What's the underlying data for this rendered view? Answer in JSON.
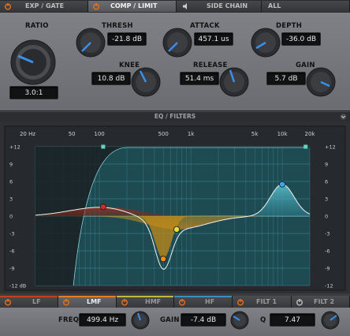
{
  "tabs": [
    {
      "label": "EXP / GATE",
      "active": false
    },
    {
      "label": "COMP / LIMIT",
      "active": true
    },
    {
      "label": "SIDE CHAIN",
      "active": false
    },
    {
      "label": "ALL",
      "active": false
    }
  ],
  "dynamics": {
    "ratio": {
      "label": "RATIO",
      "value": "3.0:1"
    },
    "thresh": {
      "label": "THRESH",
      "value": "-21.8 dB"
    },
    "knee": {
      "label": "KNEE",
      "value": "10.8 dB"
    },
    "attack": {
      "label": "ATTACK",
      "value": "457.1 us"
    },
    "release": {
      "label": "RELEASE",
      "value": "51.4 ms"
    },
    "depth": {
      "label": "DEPTH",
      "value": "-36.0 dB"
    },
    "gain": {
      "label": "GAIN",
      "value": "5.7 dB"
    }
  },
  "eq": {
    "title": "EQ / FILTERS",
    "freq_labels": [
      "20 Hz",
      "50",
      "100",
      "500",
      "1k",
      "5k",
      "10k",
      "20k"
    ],
    "db_labels": [
      "+12",
      "9",
      "6",
      "3",
      "0",
      "-3",
      "-6",
      "-9",
      "-12 dB"
    ],
    "db_labels_right": [
      "+12",
      "9",
      "6",
      "3",
      "0",
      "-3",
      "-6",
      "-9",
      "-12"
    ],
    "nodes": [
      {
        "band": "LMF",
        "freq_hz": 499.4,
        "gain_db": -7.4,
        "color": "#f08a1a"
      },
      {
        "band": "LF",
        "freq_hz": 110,
        "gain_db": 1.6,
        "color": "#d42a2a"
      },
      {
        "band": "HMF",
        "freq_hz": 700,
        "gain_db": -2.3,
        "color": "#e6e23a"
      },
      {
        "band": "HF",
        "freq_hz": 10000,
        "gain_db": 5.5,
        "color": "#3aa6e8"
      }
    ]
  },
  "bands": [
    {
      "label": "LF",
      "color": "#c04020",
      "active": false
    },
    {
      "label": "LMF",
      "color": "#e08020",
      "active": true
    },
    {
      "label": "HMF",
      "color": "#c0b840",
      "active": false
    },
    {
      "label": "HF",
      "color": "#3a90b8",
      "active": false
    },
    {
      "label": "FILT 1",
      "color": "#5a5c60",
      "active": false
    },
    {
      "label": "FILT 2",
      "color": "#5a5c60",
      "active": false
    }
  ],
  "band_controls": {
    "freq": {
      "label": "FREQ",
      "value": "499.4 Hz"
    },
    "gain": {
      "label": "GAIN",
      "value": "-7.4 dB"
    },
    "q": {
      "label": "Q",
      "value": "7.47"
    }
  },
  "colors": {
    "active_power": "#e8701a",
    "accent_blue": "#3a8fe8"
  }
}
